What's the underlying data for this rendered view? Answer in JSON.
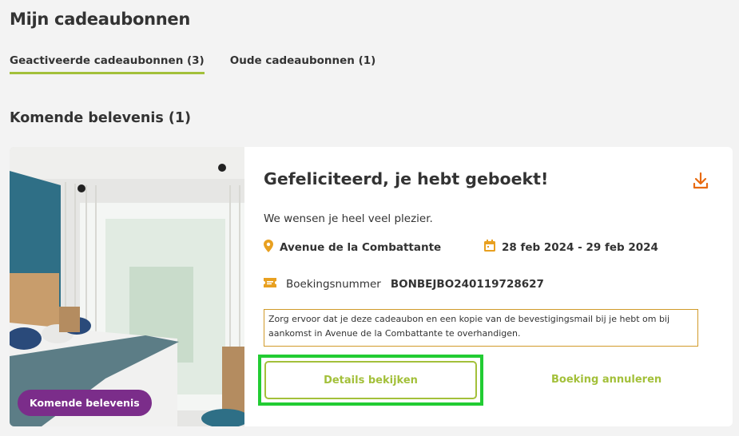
{
  "page": {
    "title": "Mijn cadeaubonnen"
  },
  "tabs": [
    {
      "label": "Geactiveerde cadeaubonnen (3)",
      "active": true
    },
    {
      "label": "Oude cadeaubonnen (1)",
      "active": false
    }
  ],
  "section": {
    "title": "Komende belevenis (1)"
  },
  "card": {
    "badge": "Komende belevenis",
    "title": "Gefeliciteerd, je hebt geboekt!",
    "subtext": "We wensen je heel veel plezier.",
    "location": "Avenue de la Combattante",
    "dates": "28 feb 2024 - 29 feb 2024",
    "booking_label": "Boekingsnummer",
    "booking_number": "BONBEJBO240119728627",
    "notice": "Zorg ervoor dat je deze cadeaubon en een kopie van de bevestigingsmail bij je hebt om bij aankomst in Avenue de la Combattante te overhandigen.",
    "details_button": "Details bekijken",
    "cancel_button": "Boeking annuleren"
  },
  "colors": {
    "accent_green": "#a3c03a",
    "icon_orange": "#e8a020",
    "download_orange": "#e86a10",
    "badge_purple": "#7b2d8a",
    "notice_border": "#d19a2a",
    "highlight": "#22cc33"
  },
  "icons": {
    "download": "download-icon",
    "location": "map-pin-icon",
    "calendar": "calendar-icon",
    "ticket": "ticket-icon"
  }
}
